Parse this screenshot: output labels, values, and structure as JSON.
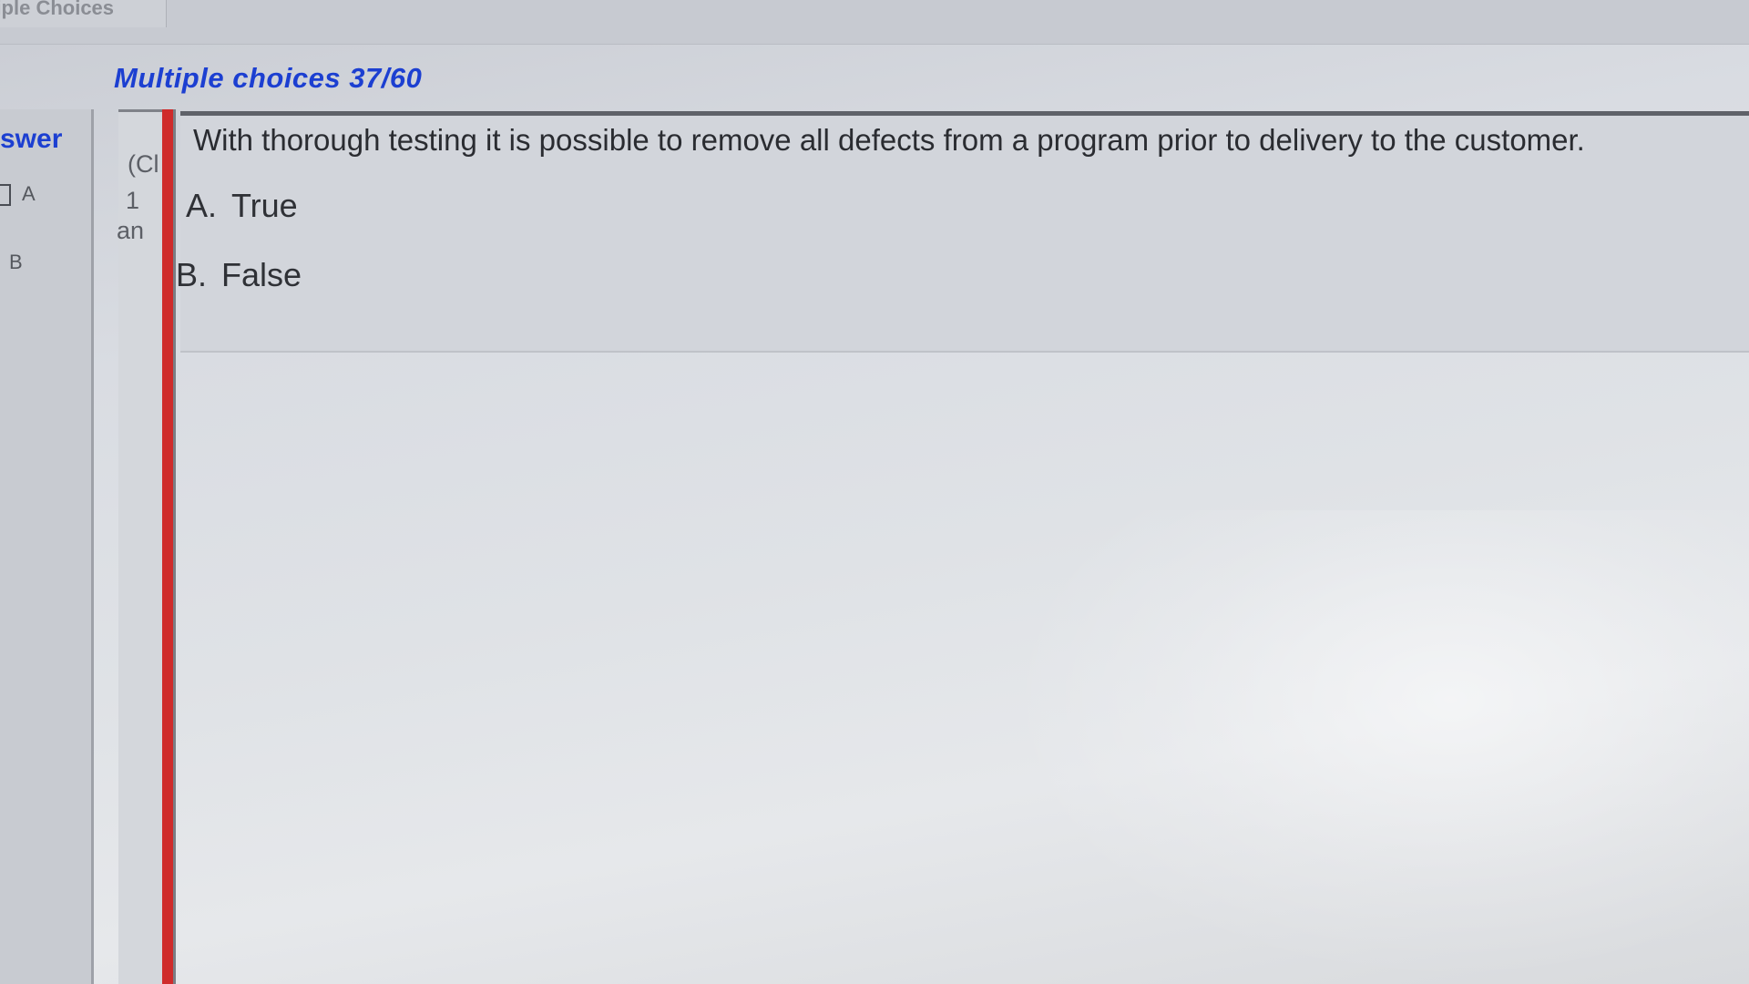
{
  "tab": {
    "label": "ltiple Choices"
  },
  "header": {
    "title": "Multiple choices 37/60"
  },
  "answer_panel": {
    "heading": "swer",
    "options": [
      {
        "label": "A"
      },
      {
        "label": "B"
      }
    ]
  },
  "middle_column": {
    "lines": [
      "(Cl",
      "1",
      "an"
    ]
  },
  "question": {
    "text": "With thorough testing it is possible to remove all defects from a program prior to delivery to the customer.",
    "options": [
      {
        "letter": "A.",
        "text": "True"
      },
      {
        "letter": "B.",
        "text": "False"
      }
    ]
  },
  "colors": {
    "accent_blue": "#1c3fd1",
    "rail_red": "#cf2b2b"
  }
}
